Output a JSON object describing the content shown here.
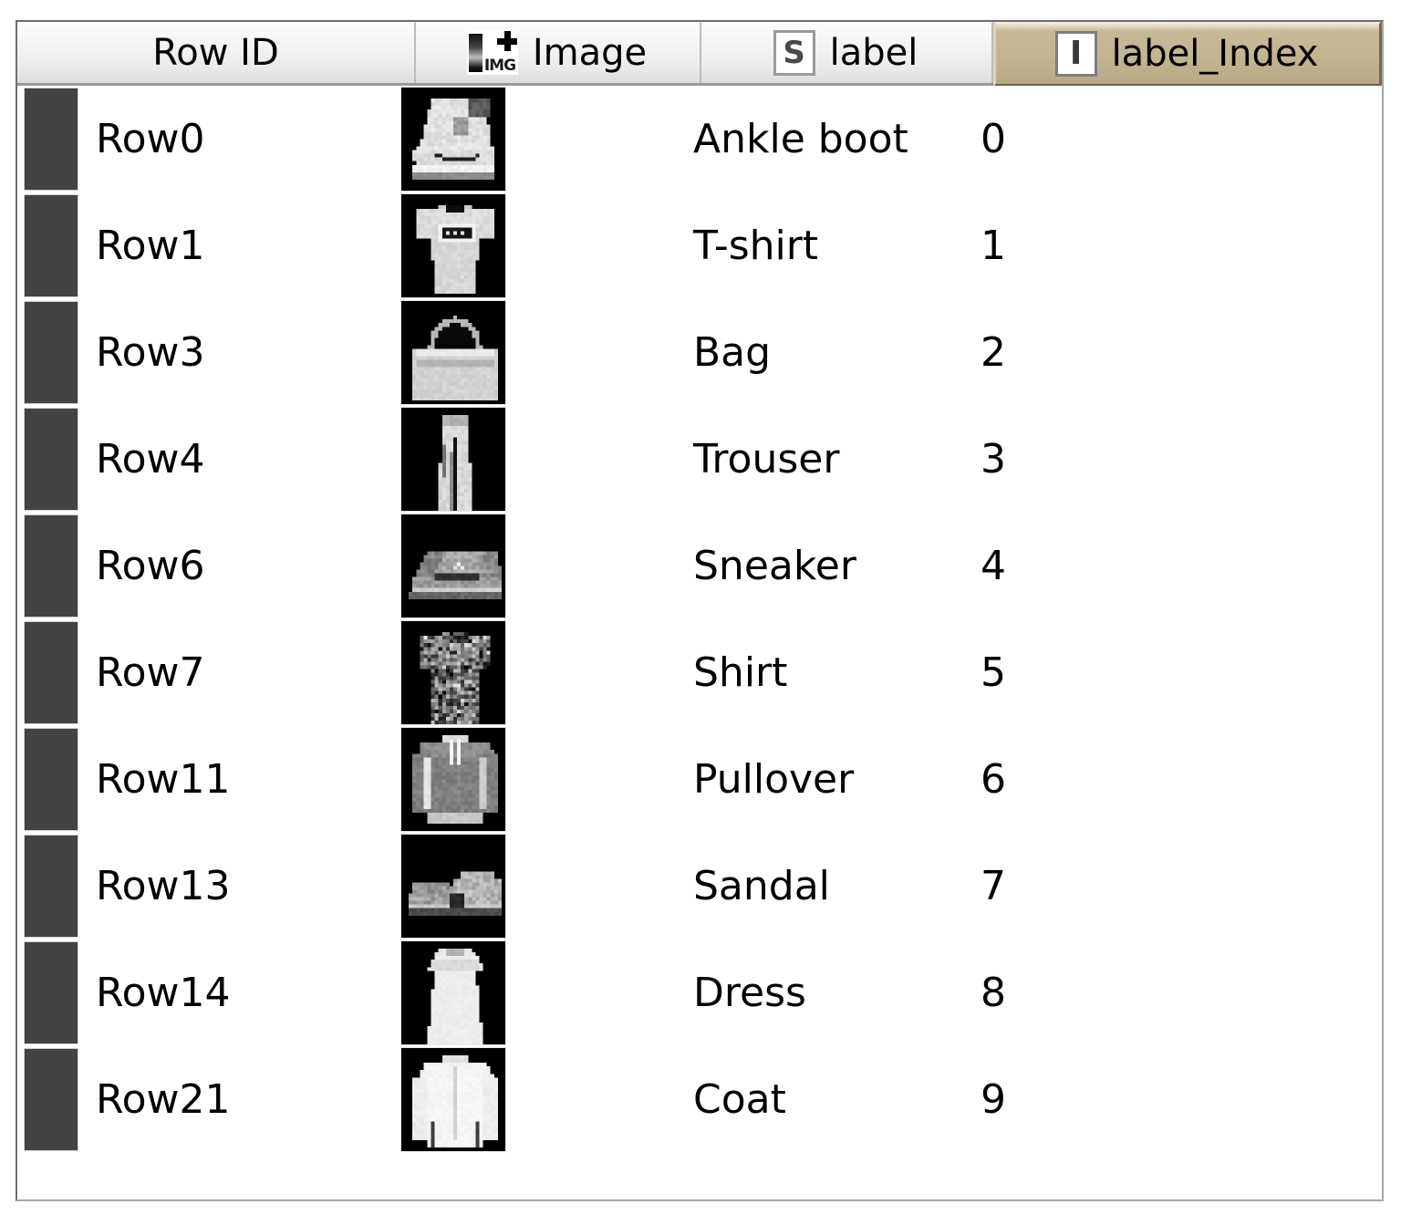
{
  "window": {
    "type": "data-table-view"
  },
  "colors": {
    "selected_header_bg": "#c1b491",
    "header_bg": "#f0f0f0",
    "row_color_swatch": "#434343",
    "thumbnail_bg": "#000000",
    "text": "#000000",
    "frame_border": "#8d8d8d"
  },
  "header": {
    "columns": [
      {
        "id": "row-id",
        "label": "Row ID",
        "icon": "none",
        "selected": false
      },
      {
        "id": "image",
        "label": "Image",
        "icon": "image-icon",
        "selected": false
      },
      {
        "id": "label",
        "label": "label",
        "icon": "string-icon",
        "icon_glyph": "S",
        "selected": false
      },
      {
        "id": "label-index",
        "label": "label_Index",
        "icon": "integer-icon",
        "icon_glyph": "I",
        "selected": true
      }
    ]
  },
  "table": {
    "column_headers": [
      "Row ID",
      "Image",
      "label",
      "label_Index"
    ],
    "rows": [
      {
        "row_id": "Row0",
        "image_alt": "ankle-boot-thumbnail",
        "label": "Ankle boot",
        "label_index": "0"
      },
      {
        "row_id": "Row1",
        "image_alt": "t-shirt-thumbnail",
        "label": "T-shirt",
        "label_index": "1"
      },
      {
        "row_id": "Row3",
        "image_alt": "bag-thumbnail",
        "label": "Bag",
        "label_index": "2"
      },
      {
        "row_id": "Row4",
        "image_alt": "trouser-thumbnail",
        "label": "Trouser",
        "label_index": "3"
      },
      {
        "row_id": "Row6",
        "image_alt": "sneaker-thumbnail",
        "label": "Sneaker",
        "label_index": "4"
      },
      {
        "row_id": "Row7",
        "image_alt": "shirt-thumbnail",
        "label": "Shirt",
        "label_index": "5"
      },
      {
        "row_id": "Row11",
        "image_alt": "pullover-thumbnail",
        "label": "Pullover",
        "label_index": "6"
      },
      {
        "row_id": "Row13",
        "image_alt": "sandal-thumbnail",
        "label": "Sandal",
        "label_index": "7"
      },
      {
        "row_id": "Row14",
        "image_alt": "dress-thumbnail",
        "label": "Dress",
        "label_index": "8"
      },
      {
        "row_id": "Row21",
        "image_alt": "coat-thumbnail",
        "label": "Coat",
        "label_index": "9"
      }
    ]
  }
}
